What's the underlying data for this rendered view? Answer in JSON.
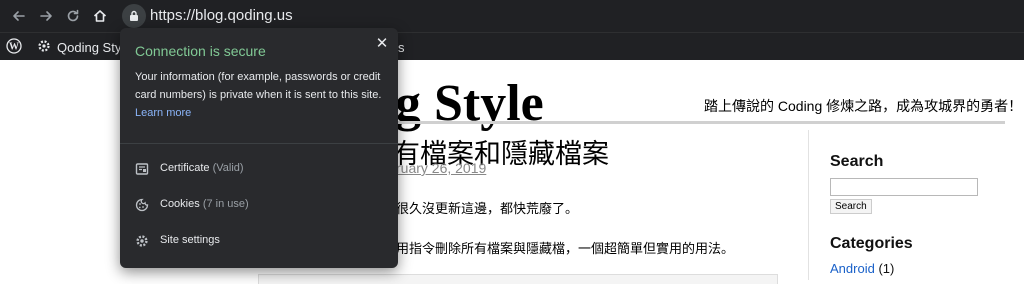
{
  "browser": {
    "url": "https://blog.qoding.us",
    "icons": {
      "back": "back-arrow-icon",
      "forward": "forward-arrow-icon",
      "reload": "reload-icon",
      "home": "home-icon",
      "lock": "lock-icon"
    }
  },
  "bookmarks": {
    "items": [
      {
        "label": "",
        "icon": "wordpress-icon"
      },
      {
        "label": "Qoding Styl",
        "icon": "settings-gear-icon"
      }
    ],
    "partial_label": "s"
  },
  "site": {
    "title_visible": "g Style",
    "tagline": "踏上傳說的 Coding 修煉之路，成為攻城界的勇者！"
  },
  "post": {
    "title_visible": "有檔案和隱藏檔案",
    "date_visible": "ruary 26, 2019",
    "para1_visible": "很久沒更新這邊，都快荒廢了。",
    "para2_visible": "用指令刪除所有檔案與隱藏檔，一個超簡單但實用的用法。"
  },
  "sidebar": {
    "search_heading": "Search",
    "search_button": "Search",
    "search_value": "",
    "categories_heading": "Categories",
    "categories": [
      {
        "name": "Android",
        "count": "(1)"
      }
    ]
  },
  "popup": {
    "title": "Connection is secure",
    "body": "Your information (for example, passwords or credit card numbers) is private when it is sent to this site.",
    "learn_more": "Learn more",
    "close_icon": "close-icon",
    "rows": [
      {
        "label": "Certificate",
        "sub": "(Valid)",
        "icon": "certificate-icon"
      },
      {
        "label": "Cookies",
        "sub": "(7 in use)",
        "icon": "cookie-icon"
      },
      {
        "label": "Site settings",
        "sub": "",
        "icon": "settings-gear-icon"
      }
    ]
  },
  "colors": {
    "chrome_bg": "#202124",
    "popup_bg": "#292a2d",
    "secure_green": "#81c995",
    "link_blue": "#8ab4f8",
    "category_link": "#1a61c9"
  }
}
